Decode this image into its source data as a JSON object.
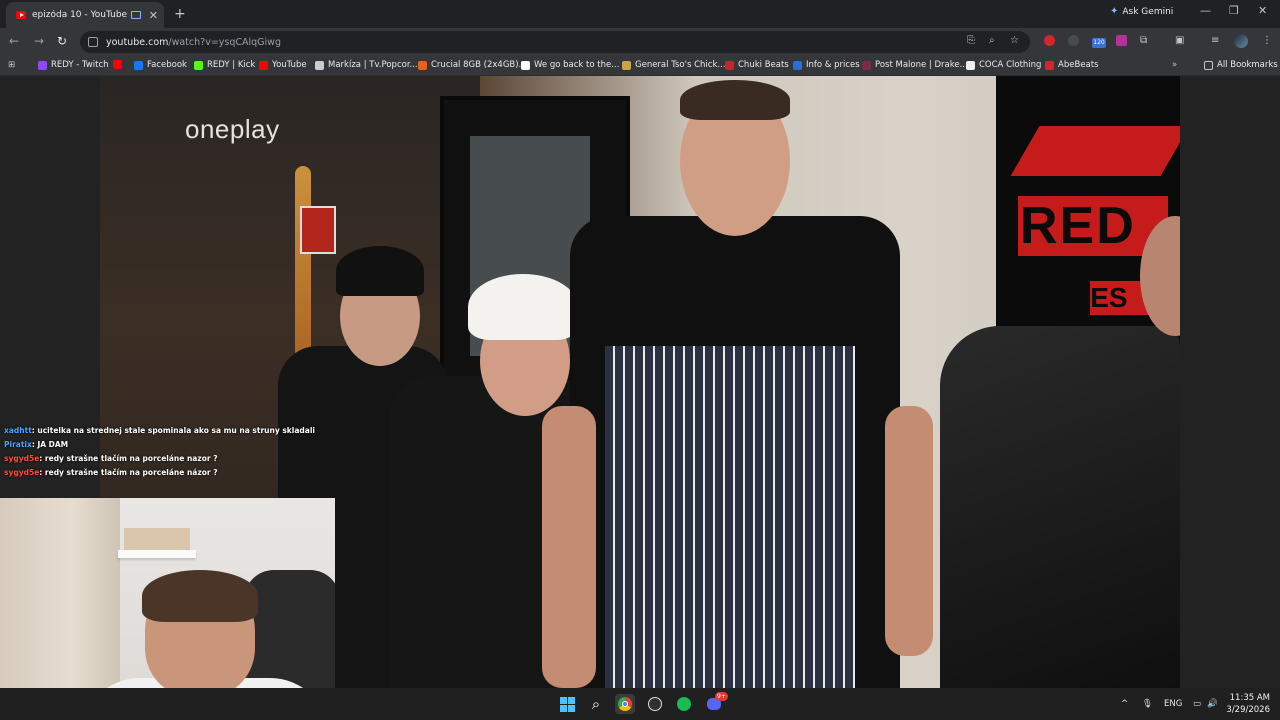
{
  "browser": {
    "tab_title": "epizóda 10 - YouTube",
    "new_tab": "+",
    "ask_gemini": "Ask Gemini",
    "url_host": "youtube.com",
    "url_path": "/watch?v=ysqCAlqGiwg",
    "all_bookmarks": "All Bookmarks",
    "extension_badge": "120"
  },
  "bookmarks": [
    {
      "label": "REDY - Twitch",
      "color": "#9146ff"
    },
    {
      "label": "",
      "color": "#ff0000"
    },
    {
      "label": "Facebook",
      "color": "#1877f2"
    },
    {
      "label": "REDY | Kick",
      "color": "#53fc18"
    },
    {
      "label": "YouTube",
      "color": "#ff0000"
    },
    {
      "label": "Markíza | Tv.Popcor...",
      "color": "#cccccc"
    },
    {
      "label": "Crucial 8GB (2x4GB)...",
      "color": "#e8621a"
    },
    {
      "label": "We go back to the...",
      "color": "#ffffff"
    },
    {
      "label": "General Tso's Chick...",
      "color": "#c9a24a"
    },
    {
      "label": "Chuki Beats",
      "color": "#c0282d"
    },
    {
      "label": "Info & prices",
      "color": "#2b6cd4"
    },
    {
      "label": "Post Malone | Drake...",
      "color": "#7a2a4a"
    },
    {
      "label": "COCA Clothing",
      "color": "#eeeeee"
    },
    {
      "label": "AbeBeats",
      "color": "#d0262c"
    }
  ],
  "video": {
    "watermark": "oneplay",
    "poster_text_1": "RED",
    "poster_text_2": "RES"
  },
  "chat": [
    {
      "user": "xadhtt",
      "user_color": "#4aa3ff",
      "message": ": ucitelka na strednej stale spominala ako sa mu na struny skladali"
    },
    {
      "user": "Piratix",
      "user_color": "#4aa3ff",
      "message": ": JA DAM"
    },
    {
      "user": "sygyd5e",
      "user_color": "#ff4a3a",
      "message": ": redy strašne tlačím na porceláne nazor ?"
    },
    {
      "user": "sygyd5e",
      "user_color": "#ff4a3a",
      "message": ": redy strašne tlačím na porceláne názor ?"
    }
  ],
  "taskbar": {
    "lang": "ENG",
    "time": "11:35 AM",
    "date": "3/29/2026",
    "discord_badge": "9+"
  }
}
